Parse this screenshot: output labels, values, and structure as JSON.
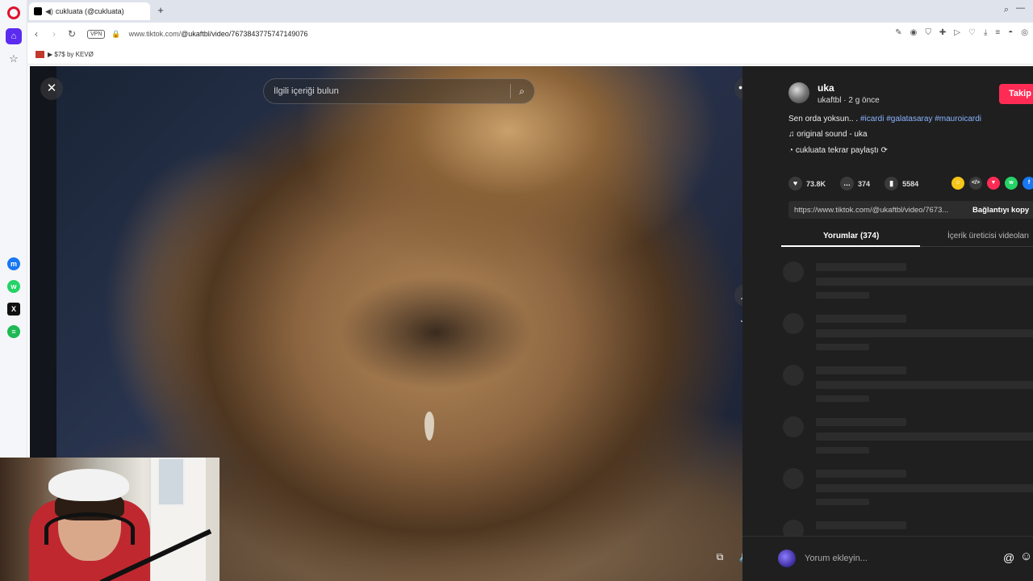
{
  "browser": {
    "tab_title": "cukluata (@cukluata)",
    "new_tab": "+",
    "url_prefix": "www.tiktok.com/",
    "url_rest": "@ukaftbl/video/7673843775747149076",
    "vpn": "VPN",
    "bookmark": "$7$ by KEVØ"
  },
  "search": {
    "placeholder": "İlgili içeriği bulun"
  },
  "author": {
    "name": "uka",
    "handle_time": "ukaftbl · 2 g önce",
    "follow": "Takip"
  },
  "post": {
    "desc_text": "Sen orda yoksun.. .",
    "tags": "#icardi #galatasaray #mauroicardi",
    "sound": "original sound - uka",
    "repost": "cukluata tekrar paylaştı"
  },
  "stats": {
    "likes": "73.8K",
    "comments": "374",
    "saves": "5584"
  },
  "link": {
    "url": "https://www.tiktok.com/@ukaftbl/video/7673...",
    "copy": "Bağlantıyı kopy"
  },
  "tabs": {
    "comments": "Yorumlar (374)",
    "creator": "İçerik üreticisi videoları"
  },
  "comment_bar": {
    "placeholder": "Yorum ekleyin...",
    "at": "@",
    "emoji": "☺"
  },
  "icons": {
    "close": "✕",
    "more": "•••",
    "up": "︿",
    "down": "﹀",
    "volume": "🔊",
    "search": "⌕",
    "note": "♫",
    "repost": "⟳"
  }
}
